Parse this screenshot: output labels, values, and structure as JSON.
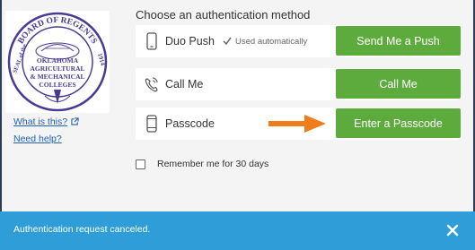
{
  "logo": {
    "name": "oklahoma-amc-seal",
    "top_text": "BOARD OF REGENTS",
    "left_text": "SEAL of the",
    "right_text": "1914",
    "center_lines": [
      "OKLAHOMA",
      "AGRICULTURAL",
      "& MECHANICAL",
      "COLLEGES"
    ]
  },
  "links": {
    "what_is_this": "What is this?",
    "need_help": "Need help?"
  },
  "heading": "Choose an authentication method",
  "methods": [
    {
      "icon": "phone-icon",
      "label": "Duo Push",
      "note": "Used automatically",
      "button": "Send Me a Push"
    },
    {
      "icon": "call-icon",
      "label": "Call Me",
      "note": "",
      "button": "Call Me"
    },
    {
      "icon": "passcode-phone-icon",
      "label": "Passcode",
      "note": "",
      "button": "Enter a Passcode"
    }
  ],
  "remember": {
    "label": "Remember me for 30 days",
    "checked": false
  },
  "banner": {
    "text": "Authentication request canceled."
  },
  "colors": {
    "accent_green": "#5dab3c",
    "banner_blue": "#2f9ed8",
    "arrow_orange": "#f07d1b",
    "link_blue": "#1f5fb5",
    "seal_purple": "#4b3a92"
  }
}
